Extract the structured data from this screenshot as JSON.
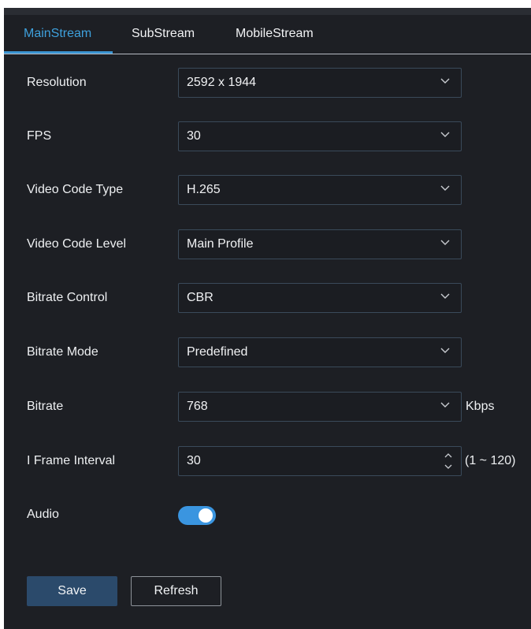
{
  "tabs": [
    {
      "label": "MainStream",
      "active": true
    },
    {
      "label": "SubStream",
      "active": false
    },
    {
      "label": "MobileStream",
      "active": false
    }
  ],
  "fields": {
    "resolution": {
      "label": "Resolution",
      "value": "2592 x 1944"
    },
    "fps": {
      "label": "FPS",
      "value": "30"
    },
    "video_code_type": {
      "label": "Video Code Type",
      "value": "H.265"
    },
    "video_code_level": {
      "label": "Video Code Level",
      "value": "Main Profile"
    },
    "bitrate_control": {
      "label": "Bitrate Control",
      "value": "CBR"
    },
    "bitrate_mode": {
      "label": "Bitrate Mode",
      "value": "Predefined"
    },
    "bitrate": {
      "label": "Bitrate",
      "value": "768",
      "unit": "Kbps"
    },
    "i_frame_interval": {
      "label": "I Frame Interval",
      "value": "30",
      "range": "(1 ~ 120)"
    },
    "audio": {
      "label": "Audio",
      "enabled": true
    }
  },
  "buttons": {
    "save": "Save",
    "refresh": "Refresh"
  },
  "colors": {
    "accent": "#3a95d3",
    "background": "#1d1f24",
    "save_button": "#2b4a6b",
    "toggle_on": "#3a95e0"
  },
  "icons": {
    "dropdown": "chevron-down-icon",
    "spinner": "stepper-icon"
  }
}
